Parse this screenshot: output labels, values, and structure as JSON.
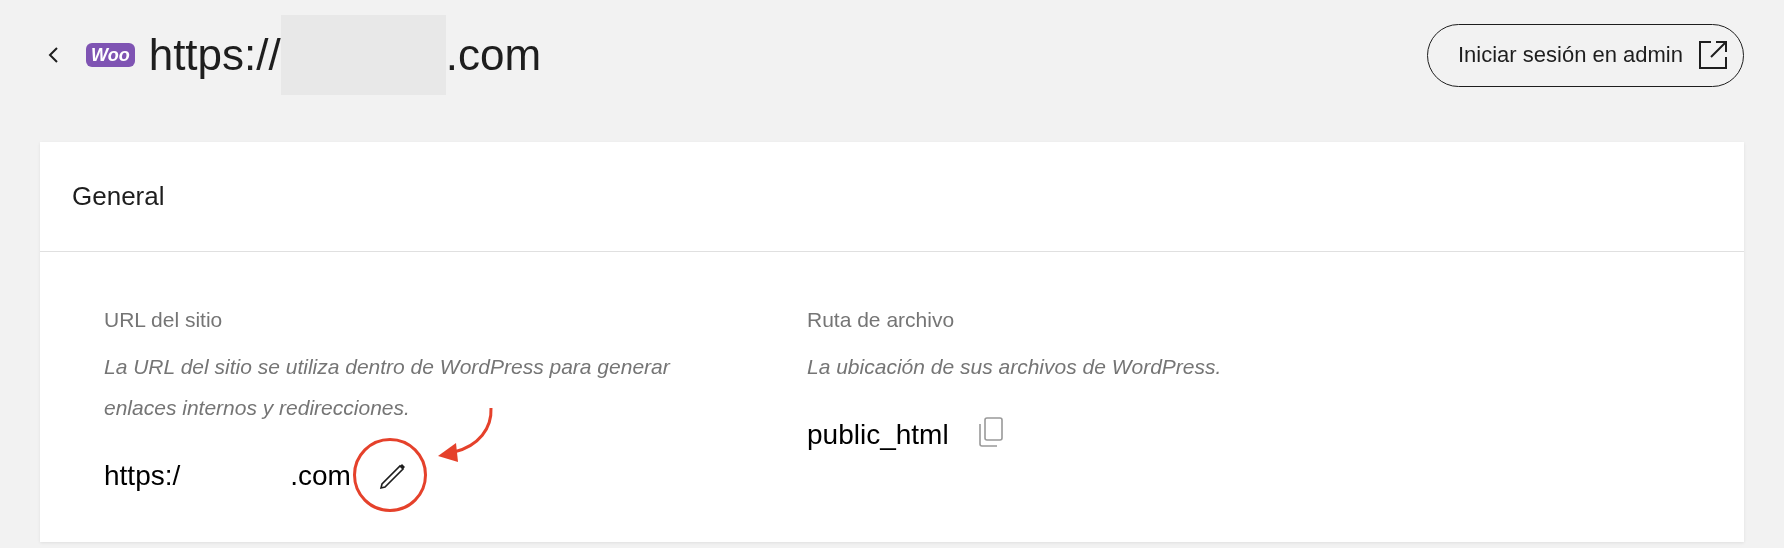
{
  "header": {
    "logo_text": "Woo",
    "title_parts": [
      "https://",
      ".com"
    ],
    "admin_button": "Iniciar sesión en admin"
  },
  "card": {
    "title": "General",
    "fields": [
      {
        "kind": "editable",
        "label": "URL del sitio",
        "description": "La URL del sitio se utiliza dentro de WordPress para generar enlaces internos y redirecciones.",
        "value_parts": [
          "https:/",
          ".com"
        ]
      },
      {
        "kind": "copyable",
        "label": "Ruta de archivo",
        "description": "La ubicación de sus archivos de WordPress.",
        "value_parts": [
          "public_html"
        ]
      }
    ]
  }
}
